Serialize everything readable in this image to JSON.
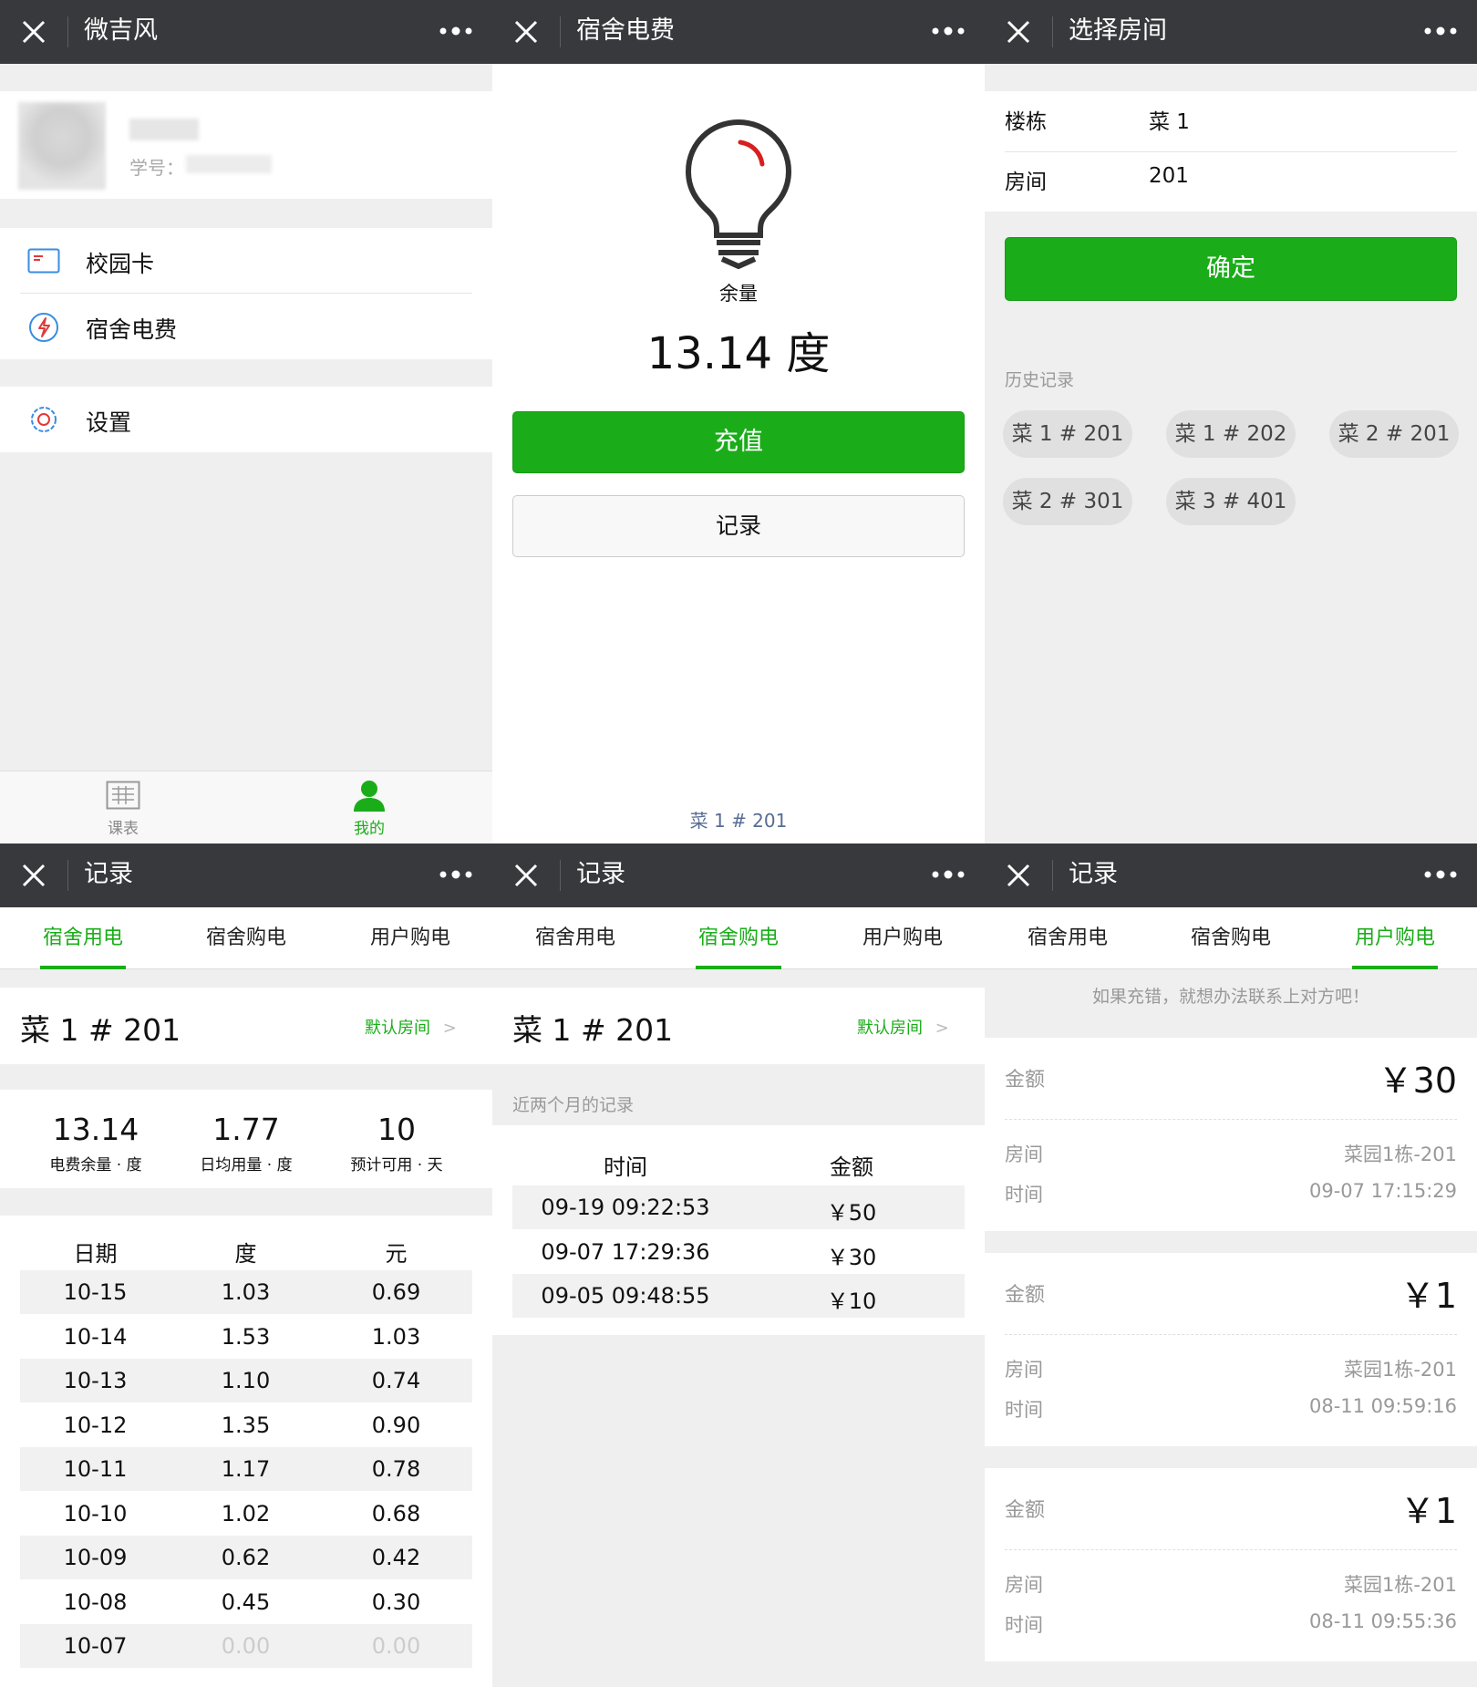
{
  "panel_home": {
    "title": "微吉风",
    "student_id_label": "学号：",
    "menu": [
      {
        "label": "校园卡",
        "icon": "card-icon"
      },
      {
        "label": "宿舍电费",
        "icon": "lightning-icon"
      },
      {
        "label": "设置",
        "icon": "settings-gear-icon"
      }
    ],
    "tabbar": [
      {
        "label": "课表",
        "icon": "timetable-icon"
      },
      {
        "label": "我的",
        "icon": "person-icon"
      }
    ],
    "colors": {
      "accent": "#1aad19",
      "nav_bg": "#38393d"
    }
  },
  "panel_fee": {
    "title": "宿舍电费",
    "remain_label": "余量",
    "remain_value": "13.14 度",
    "recharge_label": "充值",
    "record_label": "记录",
    "room": "菜 1 # 201"
  },
  "panel_select": {
    "title": "选择房间",
    "building_label": "楼栋",
    "building_value": "菜 1",
    "room_label": "房间",
    "room_value": "201",
    "confirm_label": "确定",
    "history_label": "历史记录",
    "history": [
      "菜 1 # 201",
      "菜 1 # 202",
      "菜 2 # 201",
      "菜 2 # 301",
      "菜 3 # 401"
    ]
  },
  "panel_usage": {
    "title": "记录",
    "tabs": [
      "宿舍用电",
      "宿舍购电",
      "用户购电"
    ],
    "room": "菜 1 # 201",
    "default_room": "默认房间",
    "stats": [
      {
        "value": "13.14",
        "label": "电费余量 · 度"
      },
      {
        "value": "1.77",
        "label": "日均用量 · 度"
      },
      {
        "value": "10",
        "label": "预计可用 · 天"
      }
    ],
    "headers": [
      "日期",
      "度",
      "元"
    ],
    "rows": [
      [
        "10-15",
        "1.03",
        "0.69"
      ],
      [
        "10-14",
        "1.53",
        "1.03"
      ],
      [
        "10-13",
        "1.10",
        "0.74"
      ],
      [
        "10-12",
        "1.35",
        "0.90"
      ],
      [
        "10-11",
        "1.17",
        "0.78"
      ],
      [
        "10-10",
        "1.02",
        "0.68"
      ],
      [
        "10-09",
        "0.62",
        "0.42"
      ],
      [
        "10-08",
        "0.45",
        "0.30"
      ],
      [
        "10-07",
        "0.00",
        "0.00"
      ]
    ]
  },
  "panel_purchase": {
    "title": "记录",
    "tabs": [
      "宿舍用电",
      "宿舍购电",
      "用户购电"
    ],
    "room": "菜 1 # 201",
    "default_room": "默认房间",
    "recent_label": "近两个月的记录",
    "headers": [
      "时间",
      "金额"
    ],
    "rows": [
      [
        "09-19 09:22:53",
        "￥50"
      ],
      [
        "09-07 17:29:36",
        "￥30"
      ],
      [
        "09-05 09:48:55",
        "￥10"
      ]
    ]
  },
  "panel_user": {
    "title": "记录",
    "tabs": [
      "宿舍用电",
      "宿舍购电",
      "用户购电"
    ],
    "notice": "如果充错，就想办法联系上对方吧！",
    "amount_label": "金额",
    "room_label": "房间",
    "time_label": "时间",
    "cards": [
      {
        "amount": "￥30",
        "room": "菜园1栋-201",
        "time": "09-07 17:15:29"
      },
      {
        "amount": "￥1",
        "room": "菜园1栋-201",
        "time": "08-11 09:59:16"
      },
      {
        "amount": "￥1",
        "room": "菜园1栋-201",
        "time": "08-11 09:55:36"
      }
    ]
  }
}
